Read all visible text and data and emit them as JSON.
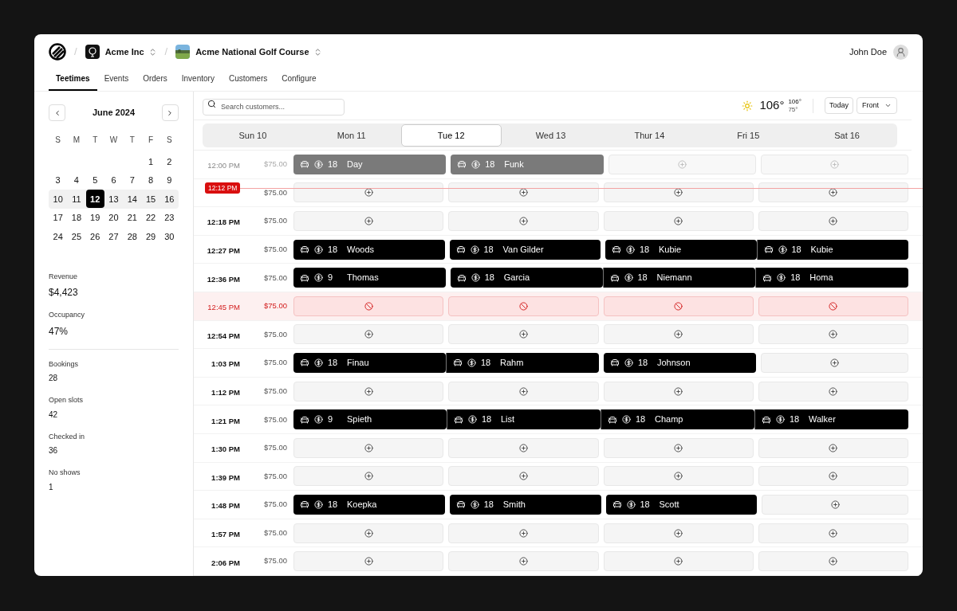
{
  "breadcrumb": {
    "separators": [
      "/",
      "/"
    ],
    "org": "Acme Inc",
    "course": "Acme National Golf Course"
  },
  "user": {
    "name": "John Doe"
  },
  "nav": [
    {
      "label": "Teetimes",
      "selected": true
    },
    {
      "label": "Events",
      "selected": false
    },
    {
      "label": "Orders",
      "selected": false
    },
    {
      "label": "Inventory",
      "selected": false
    },
    {
      "label": "Customers",
      "selected": false
    },
    {
      "label": "Configure",
      "selected": false
    }
  ],
  "calendar": {
    "month": "June 2024",
    "weekdays": [
      "S",
      "M",
      "T",
      "W",
      "T",
      "F",
      "S"
    ],
    "weeks": [
      {
        "days": [
          {
            "label": "1",
            "selected": false
          },
          {
            "label": "2",
            "selected": false
          }
        ],
        "current": false
      },
      {
        "days": [
          {
            "label": "3",
            "selected": false
          },
          {
            "label": "4",
            "selected": false
          },
          {
            "label": "5",
            "selected": false
          },
          {
            "label": "6",
            "selected": false
          },
          {
            "label": "7",
            "selected": false
          },
          {
            "label": "8",
            "selected": false
          },
          {
            "label": "9",
            "selected": false
          }
        ],
        "current": false
      },
      {
        "days": [
          {
            "label": "10",
            "selected": false
          },
          {
            "label": "11",
            "selected": false
          },
          {
            "label": "12",
            "selected": true
          },
          {
            "label": "13",
            "selected": false
          },
          {
            "label": "14",
            "selected": false
          },
          {
            "label": "15",
            "selected": false
          },
          {
            "label": "16",
            "selected": false
          }
        ],
        "current": true
      },
      {
        "days": [
          {
            "label": "17",
            "selected": false
          },
          {
            "label": "18",
            "selected": false
          },
          {
            "label": "19",
            "selected": false
          },
          {
            "label": "20",
            "selected": false
          },
          {
            "label": "21",
            "selected": false
          },
          {
            "label": "22",
            "selected": false
          },
          {
            "label": "23",
            "selected": false
          }
        ],
        "current": false
      },
      {
        "days": [
          {
            "label": "24",
            "selected": false
          },
          {
            "label": "25",
            "selected": false
          },
          {
            "label": "26",
            "selected": false
          },
          {
            "label": "27",
            "selected": false
          },
          {
            "label": "28",
            "selected": false
          },
          {
            "label": "29",
            "selected": false
          },
          {
            "label": "30",
            "selected": false
          }
        ],
        "current": false
      }
    ]
  },
  "highlights": [
    {
      "label": "Revenue",
      "value": "$4,423"
    },
    {
      "label": "Occupancy",
      "value": "47%"
    }
  ],
  "stats": [
    {
      "label": "Bookings",
      "value": "28"
    },
    {
      "label": "Open slots",
      "value": "42"
    },
    {
      "label": "Checked in",
      "value": "36"
    },
    {
      "label": "No shows",
      "value": "1"
    }
  ],
  "search": {
    "placeholder": "Search customers..."
  },
  "weather": {
    "temp": "106°",
    "high": "106°",
    "low": "75°"
  },
  "today_button": "Today",
  "course_select": "Front",
  "days": [
    {
      "label": "Sun 10",
      "selected": false
    },
    {
      "label": "Mon 11",
      "selected": false
    },
    {
      "label": "Tue 12",
      "selected": true
    },
    {
      "label": "Wed 13",
      "selected": false
    },
    {
      "label": "Thur 14",
      "selected": false
    },
    {
      "label": "Fri 15",
      "selected": false
    },
    {
      "label": "Sat 16",
      "selected": false
    }
  ],
  "rows": [
    {
      "time": "12:00 PM",
      "price": "$75.00",
      "past": true,
      "blocked": false,
      "slots": [
        {
          "kind": "booked",
          "holes": "18",
          "name": "Day",
          "joined": false
        },
        {
          "kind": "booked",
          "holes": "18",
          "name": "Funk",
          "joined": false
        },
        {
          "kind": "open"
        },
        {
          "kind": "open"
        }
      ]
    },
    {
      "now": "12:12 PM",
      "price": "$75.00",
      "past": false,
      "blocked": false,
      "slots": [
        {
          "kind": "open"
        },
        {
          "kind": "open"
        },
        {
          "kind": "open"
        },
        {
          "kind": "open"
        }
      ]
    },
    {
      "time": "12:18 PM",
      "price": "$75.00",
      "past": false,
      "blocked": false,
      "slots": [
        {
          "kind": "open"
        },
        {
          "kind": "open"
        },
        {
          "kind": "open"
        },
        {
          "kind": "open"
        }
      ]
    },
    {
      "time": "12:27 PM",
      "price": "$75.00",
      "past": false,
      "blocked": false,
      "slots": [
        {
          "kind": "booked",
          "holes": "18",
          "name": "Woods",
          "joined": false
        },
        {
          "kind": "booked",
          "holes": "18",
          "name": "Van Gilder",
          "joined": false
        },
        {
          "kind": "booked",
          "holes": "18",
          "name": "Kubie",
          "joined": false
        },
        {
          "kind": "booked",
          "holes": "18",
          "name": "Kubie",
          "joined": true
        }
      ]
    },
    {
      "time": "12:36 PM",
      "price": "$75.00",
      "past": false,
      "blocked": false,
      "slots": [
        {
          "kind": "booked",
          "holes": "9",
          "name": "Thomas",
          "joined": false
        },
        {
          "kind": "booked",
          "holes": "18",
          "name": "Garcia",
          "joined": false
        },
        {
          "kind": "booked",
          "holes": "18",
          "name": "Niemann",
          "joined": true
        },
        {
          "kind": "booked",
          "holes": "18",
          "name": "Homa",
          "joined": true
        }
      ]
    },
    {
      "time": "12:45 PM",
      "price": "$75.00",
      "past": false,
      "blocked": true,
      "slots": [
        {
          "kind": "blocked"
        },
        {
          "kind": "blocked"
        },
        {
          "kind": "blocked"
        },
        {
          "kind": "blocked"
        }
      ]
    },
    {
      "time": "12:54 PM",
      "price": "$75.00",
      "past": false,
      "blocked": false,
      "slots": [
        {
          "kind": "open"
        },
        {
          "kind": "open"
        },
        {
          "kind": "open"
        },
        {
          "kind": "open"
        }
      ]
    },
    {
      "time": "1:03 PM",
      "price": "$75.00",
      "past": false,
      "blocked": false,
      "slots": [
        {
          "kind": "booked",
          "holes": "18",
          "name": "Finau",
          "joined": false
        },
        {
          "kind": "booked",
          "holes": "18",
          "name": "Rahm",
          "joined": true
        },
        {
          "kind": "booked",
          "holes": "18",
          "name": "Johnson",
          "joined": false
        },
        {
          "kind": "open"
        }
      ]
    },
    {
      "time": "1:12 PM",
      "price": "$75.00",
      "past": false,
      "blocked": false,
      "slots": [
        {
          "kind": "open"
        },
        {
          "kind": "open"
        },
        {
          "kind": "open"
        },
        {
          "kind": "open"
        }
      ]
    },
    {
      "time": "1:21 PM",
      "price": "$75.00",
      "past": false,
      "blocked": false,
      "slots": [
        {
          "kind": "booked",
          "holes": "9",
          "name": "Spieth",
          "joined": false
        },
        {
          "kind": "booked",
          "holes": "18",
          "name": "List",
          "joined": true
        },
        {
          "kind": "booked",
          "holes": "18",
          "name": "Champ",
          "joined": true
        },
        {
          "kind": "booked",
          "holes": "18",
          "name": "Walker",
          "joined": true
        }
      ]
    },
    {
      "time": "1:30 PM",
      "price": "$75.00",
      "past": false,
      "blocked": false,
      "slots": [
        {
          "kind": "open"
        },
        {
          "kind": "open"
        },
        {
          "kind": "open"
        },
        {
          "kind": "open"
        }
      ]
    },
    {
      "time": "1:39 PM",
      "price": "$75.00",
      "past": false,
      "blocked": false,
      "slots": [
        {
          "kind": "open"
        },
        {
          "kind": "open"
        },
        {
          "kind": "open"
        },
        {
          "kind": "open"
        }
      ]
    },
    {
      "time": "1:48 PM",
      "price": "$75.00",
      "past": false,
      "blocked": false,
      "slots": [
        {
          "kind": "booked",
          "holes": "18",
          "name": "Koepka",
          "joined": false
        },
        {
          "kind": "booked",
          "holes": "18",
          "name": "Smith",
          "joined": false
        },
        {
          "kind": "booked",
          "holes": "18",
          "name": "Scott",
          "joined": false
        },
        {
          "kind": "open"
        }
      ]
    },
    {
      "time": "1:57 PM",
      "price": "$75.00",
      "past": false,
      "blocked": false,
      "slots": [
        {
          "kind": "open"
        },
        {
          "kind": "open"
        },
        {
          "kind": "open"
        },
        {
          "kind": "open"
        }
      ]
    },
    {
      "time": "2:06 PM",
      "price": "$75.00",
      "past": false,
      "blocked": false,
      "slots": [
        {
          "kind": "open"
        },
        {
          "kind": "open"
        },
        {
          "kind": "open"
        },
        {
          "kind": "open"
        }
      ]
    }
  ]
}
